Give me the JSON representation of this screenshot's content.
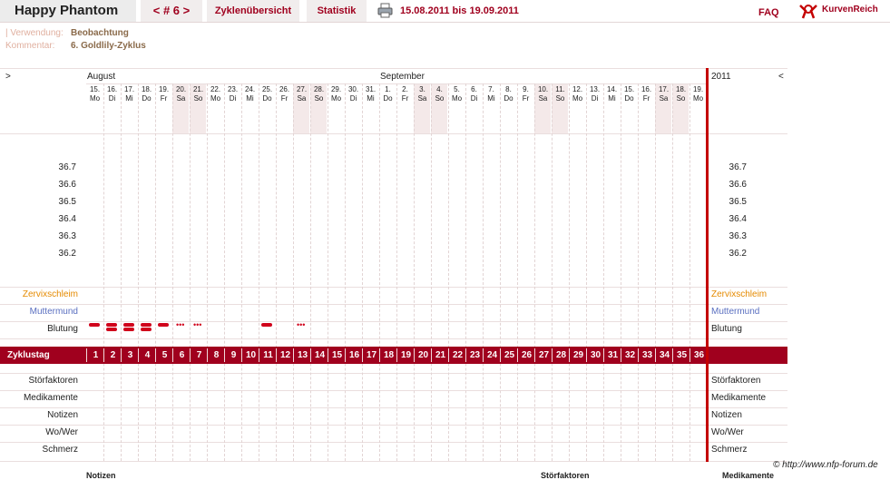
{
  "header": {
    "brand": "Happy Phantom",
    "cycle_nav": "< # 6 >",
    "tab_overview": "Zyklenübersicht",
    "tab_stats": "Statistik",
    "date_range": "15.08.2011 bis 19.09.2011",
    "faq": "FAQ",
    "logo_text": "KurvenReich"
  },
  "meta": {
    "usage_label": "| Verwendung:",
    "usage_value": "Beobachtung",
    "comment_label": "Kommentar:",
    "comment_value": "6. Goldlily-Zyklus"
  },
  "chart": {
    "nav_left": ">",
    "nav_right": "<",
    "month_aug": "August",
    "month_sep": "September",
    "year": "2011",
    "days": [
      {
        "d": "15.",
        "w": "Mo"
      },
      {
        "d": "16.",
        "w": "Di"
      },
      {
        "d": "17.",
        "w": "Mi"
      },
      {
        "d": "18.",
        "w": "Do"
      },
      {
        "d": "19.",
        "w": "Fr"
      },
      {
        "d": "20.",
        "w": "Sa"
      },
      {
        "d": "21.",
        "w": "So"
      },
      {
        "d": "22.",
        "w": "Mo"
      },
      {
        "d": "23.",
        "w": "Di"
      },
      {
        "d": "24.",
        "w": "Mi"
      },
      {
        "d": "25.",
        "w": "Do"
      },
      {
        "d": "26.",
        "w": "Fr"
      },
      {
        "d": "27.",
        "w": "Sa"
      },
      {
        "d": "28.",
        "w": "So"
      },
      {
        "d": "29.",
        "w": "Mo"
      },
      {
        "d": "30.",
        "w": "Di"
      },
      {
        "d": "31.",
        "w": "Mi"
      },
      {
        "d": "1.",
        "w": "Do"
      },
      {
        "d": "2.",
        "w": "Fr"
      },
      {
        "d": "3.",
        "w": "Sa"
      },
      {
        "d": "4.",
        "w": "So"
      },
      {
        "d": "5.",
        "w": "Mo"
      },
      {
        "d": "6.",
        "w": "Di"
      },
      {
        "d": "7.",
        "w": "Mi"
      },
      {
        "d": "8.",
        "w": "Do"
      },
      {
        "d": "9.",
        "w": "Fr"
      },
      {
        "d": "10.",
        "w": "Sa"
      },
      {
        "d": "11.",
        "w": "So"
      },
      {
        "d": "12.",
        "w": "Mo"
      },
      {
        "d": "13.",
        "w": "Di"
      },
      {
        "d": "14.",
        "w": "Mi"
      },
      {
        "d": "15.",
        "w": "Do"
      },
      {
        "d": "16.",
        "w": "Fr"
      },
      {
        "d": "17.",
        "w": "Sa"
      },
      {
        "d": "18.",
        "w": "So"
      },
      {
        "d": "19.",
        "w": "Mo"
      }
    ],
    "weekend_cols": [
      5,
      6,
      12,
      13,
      19,
      20,
      26,
      27,
      33,
      34
    ],
    "temps": [
      "36.7",
      "36.6",
      "36.5",
      "36.4",
      "36.3",
      "36.2"
    ],
    "rows": {
      "zervix": "Zervixschleim",
      "muttermund": "Muttermund",
      "blutung": "Blutung",
      "zyklustag": "Zyklustag",
      "stoer": "Störfaktoren",
      "medi": "Medikamente",
      "notizen": "Notizen",
      "wower": "Wo/Wer",
      "schmerz": "Schmerz"
    },
    "cycle_days": [
      "1",
      "2",
      "3",
      "4",
      "5",
      "6",
      "7",
      "8",
      "9",
      "10",
      "11",
      "12",
      "13",
      "14",
      "15",
      "16",
      "17",
      "18",
      "19",
      "20",
      "21",
      "22",
      "23",
      "24",
      "25",
      "26",
      "27",
      "28",
      "29",
      "30",
      "31",
      "32",
      "33",
      "34",
      "35",
      "36"
    ],
    "bleeding": [
      {
        "day": 1,
        "level": "single"
      },
      {
        "day": 2,
        "level": "double"
      },
      {
        "day": 3,
        "level": "double"
      },
      {
        "day": 4,
        "level": "double"
      },
      {
        "day": 5,
        "level": "single"
      },
      {
        "day": 6,
        "level": "dots"
      },
      {
        "day": 7,
        "level": "dots"
      },
      {
        "day": 11,
        "level": "single"
      },
      {
        "day": 13,
        "level": "dots"
      }
    ],
    "colors": {
      "accent": "#a0001e",
      "zervix": "#e58a00",
      "muttermund": "#5a6fc0",
      "bleed": "#d0021b"
    }
  },
  "footer": {
    "copyright": "© http://www.nfp-forum.de",
    "notes_hdr": "Notizen",
    "stoer_hdr": "Störfaktoren",
    "medi_hdr": "Medikamente"
  }
}
